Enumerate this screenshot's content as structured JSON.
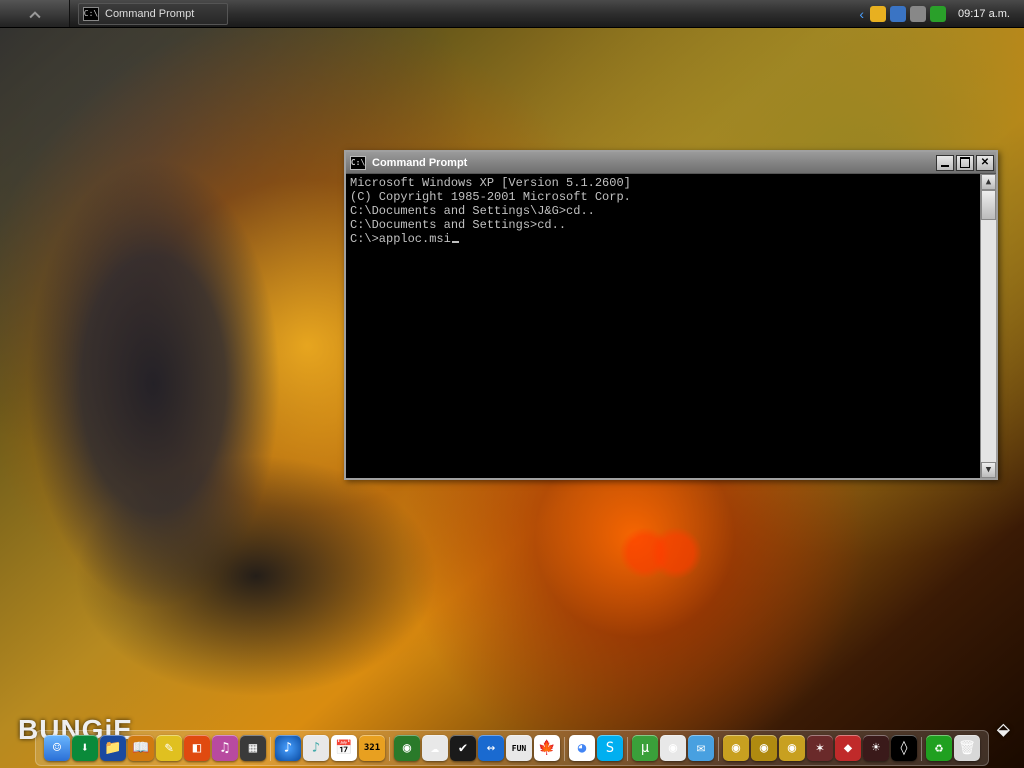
{
  "taskbar": {
    "task_label": "Command Prompt",
    "icon_text": "C:\\",
    "clock": "09:17 a.m.",
    "tray_icons": [
      {
        "name": "world-icon",
        "bg": "#e8b020"
      },
      {
        "name": "devices-icon",
        "bg": "#3a74c4"
      },
      {
        "name": "volume-icon",
        "bg": "#888"
      },
      {
        "name": "network-icon",
        "bg": "#2aa02a"
      }
    ]
  },
  "window": {
    "title": "Command Prompt",
    "icon_text": "C:\\",
    "lines": [
      "Microsoft Windows XP [Version 5.1.2600]",
      "(C) Copyright 1985-2001 Microsoft Corp.",
      "",
      "C:\\Documents and Settings\\J&G>cd..",
      "",
      "C:\\Documents and Settings>cd..",
      "",
      "C:\\>apploc.msi"
    ]
  },
  "brand": "BUNGiE",
  "dock": [
    {
      "name": "finder",
      "bg": "linear-gradient(#6bb7ff,#2a6fd6)",
      "glyph": "☺"
    },
    {
      "name": "downloads",
      "bg": "#0a8a3a",
      "glyph": "⬇"
    },
    {
      "name": "files",
      "bg": "#1a4aa0",
      "glyph": "📁"
    },
    {
      "name": "books",
      "bg": "#d07a10",
      "glyph": "📖"
    },
    {
      "name": "notes",
      "bg": "#e0c020",
      "glyph": "✎"
    },
    {
      "name": "app1",
      "bg": "#e04a10",
      "glyph": "◧"
    },
    {
      "name": "music",
      "bg": "#b84aa0",
      "glyph": "♫"
    },
    {
      "name": "grid",
      "bg": "#3a3a3a",
      "glyph": "▦"
    },
    {
      "name": "sep"
    },
    {
      "name": "itunes",
      "bg": "radial-gradient(circle,#48a0ff,#0a4aa0)",
      "glyph": "♪"
    },
    {
      "name": "note",
      "bg": "#e8e8e8",
      "glyph": "♪"
    },
    {
      "name": "calendar",
      "bg": "#fff",
      "glyph": "📅"
    },
    {
      "name": "mpc",
      "bg": "#e8a020",
      "glyph": "321"
    },
    {
      "name": "sep"
    },
    {
      "name": "browser",
      "bg": "#2a7a2a",
      "glyph": "◉"
    },
    {
      "name": "cloud",
      "bg": "#e8e8e8",
      "glyph": "☁"
    },
    {
      "name": "check",
      "bg": "#1a1a1a",
      "glyph": "✔"
    },
    {
      "name": "teamviewer",
      "bg": "#1a6ad0",
      "glyph": "↔"
    },
    {
      "name": "fun",
      "bg": "#e8e8e8",
      "glyph": "FUN"
    },
    {
      "name": "canada",
      "bg": "#fff",
      "glyph": "🍁"
    },
    {
      "name": "sep"
    },
    {
      "name": "chrome",
      "bg": "#fff",
      "glyph": "◕"
    },
    {
      "name": "skype",
      "bg": "#00aff0",
      "glyph": "S"
    },
    {
      "name": "sep"
    },
    {
      "name": "utorrent",
      "bg": "#3aa03a",
      "glyph": "µ"
    },
    {
      "name": "disc",
      "bg": "#e8e8e8",
      "glyph": "◉"
    },
    {
      "name": "mail",
      "bg": "#48a0e0",
      "glyph": "✉"
    },
    {
      "name": "sep"
    },
    {
      "name": "coin1",
      "bg": "#c8a020",
      "glyph": "◉"
    },
    {
      "name": "coin2",
      "bg": "#b08a10",
      "glyph": "◉"
    },
    {
      "name": "coin3",
      "bg": "#c8a020",
      "glyph": "◉"
    },
    {
      "name": "app2",
      "bg": "#6a2a2a",
      "glyph": "✶"
    },
    {
      "name": "app3",
      "bg": "#c02a2a",
      "glyph": "◆"
    },
    {
      "name": "app4",
      "bg": "#3a1a1a",
      "glyph": "☀"
    },
    {
      "name": "app5",
      "bg": "#000",
      "glyph": "◊"
    },
    {
      "name": "sep"
    },
    {
      "name": "recycle",
      "bg": "#20a020",
      "glyph": "♻"
    },
    {
      "name": "trash",
      "bg": "#d8d8d8",
      "glyph": "🗑"
    }
  ]
}
